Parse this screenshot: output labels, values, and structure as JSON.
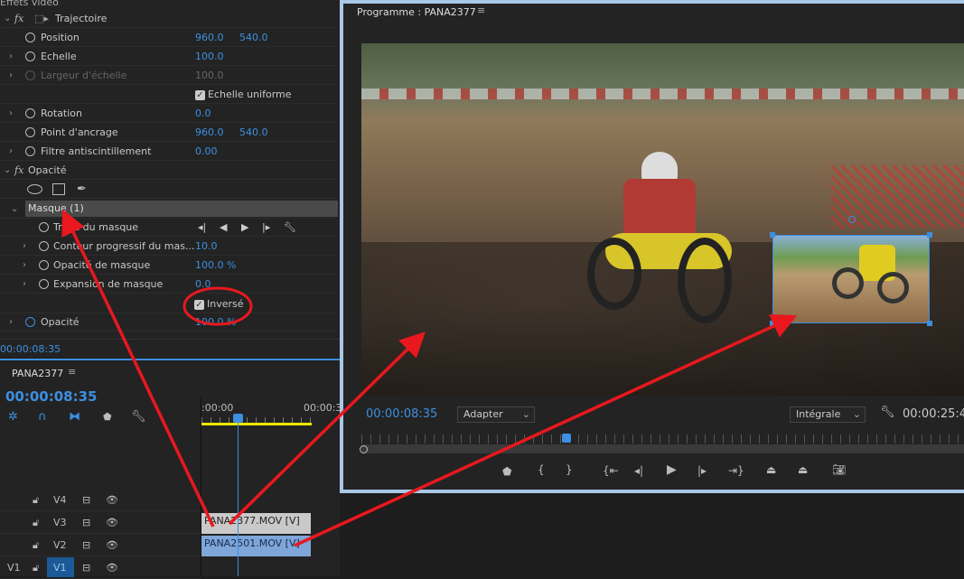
{
  "effects": {
    "header": "Effets vidéo",
    "motion": {
      "label": "Trajectoire",
      "props": [
        {
          "name": "Position",
          "v1": "960.0",
          "v2": "540.0"
        },
        {
          "name": "Echelle",
          "v1": "100.0"
        },
        {
          "name": "Largeur d'échelle",
          "v1": "100.0"
        },
        {
          "name": "Echelle uniforme"
        },
        {
          "name": "Rotation",
          "v1": "0.0"
        },
        {
          "name": "Point d'ancrage",
          "v1": "960.0",
          "v2": "540.0"
        },
        {
          "name": "Filtre antiscintillement",
          "v1": "0.00"
        }
      ]
    },
    "opacity": {
      "label": "Opacité",
      "mask": {
        "label": "Masque (1)",
        "props": [
          {
            "name": "Tracé du masque"
          },
          {
            "name": "Contour progressif du mas...",
            "v1": "10.0"
          },
          {
            "name": "Opacité de masque",
            "v1": "100.0 %"
          },
          {
            "name": "Expansion de masque",
            "v1": "0.0"
          },
          {
            "name": "Inversé",
            "checked": true
          }
        ]
      },
      "opacity_prop": {
        "name": "Opacité",
        "v1": "100.0 %"
      }
    },
    "timecode": "00:00:08:35"
  },
  "timeline": {
    "title": "PANA2377",
    "timecode": "00:00:08:35",
    "ruler": [
      ":00:00",
      "00:00:3"
    ],
    "tracks": [
      {
        "name": "V4"
      },
      {
        "name": "V3"
      },
      {
        "name": "V2"
      },
      {
        "name": "V1",
        "source": "V1"
      }
    ],
    "clips": [
      {
        "label": "PANA2377.MOV [V]",
        "track": "V3"
      },
      {
        "label": "PANA2501.MOV [V]",
        "track": "V2"
      }
    ]
  },
  "monitor": {
    "title": "Programme : PANA2377",
    "timecode": "00:00:08:35",
    "fit": "Adapter",
    "quality": "Intégrale",
    "duration": "00:00:25:4",
    "playhead_fraction": 0.34
  },
  "colors": {
    "accent": "#3d8fe0",
    "annotation": "#e8181e",
    "clip_v3": "#c9c9c9",
    "clip_v2": "#7ea6d9"
  }
}
